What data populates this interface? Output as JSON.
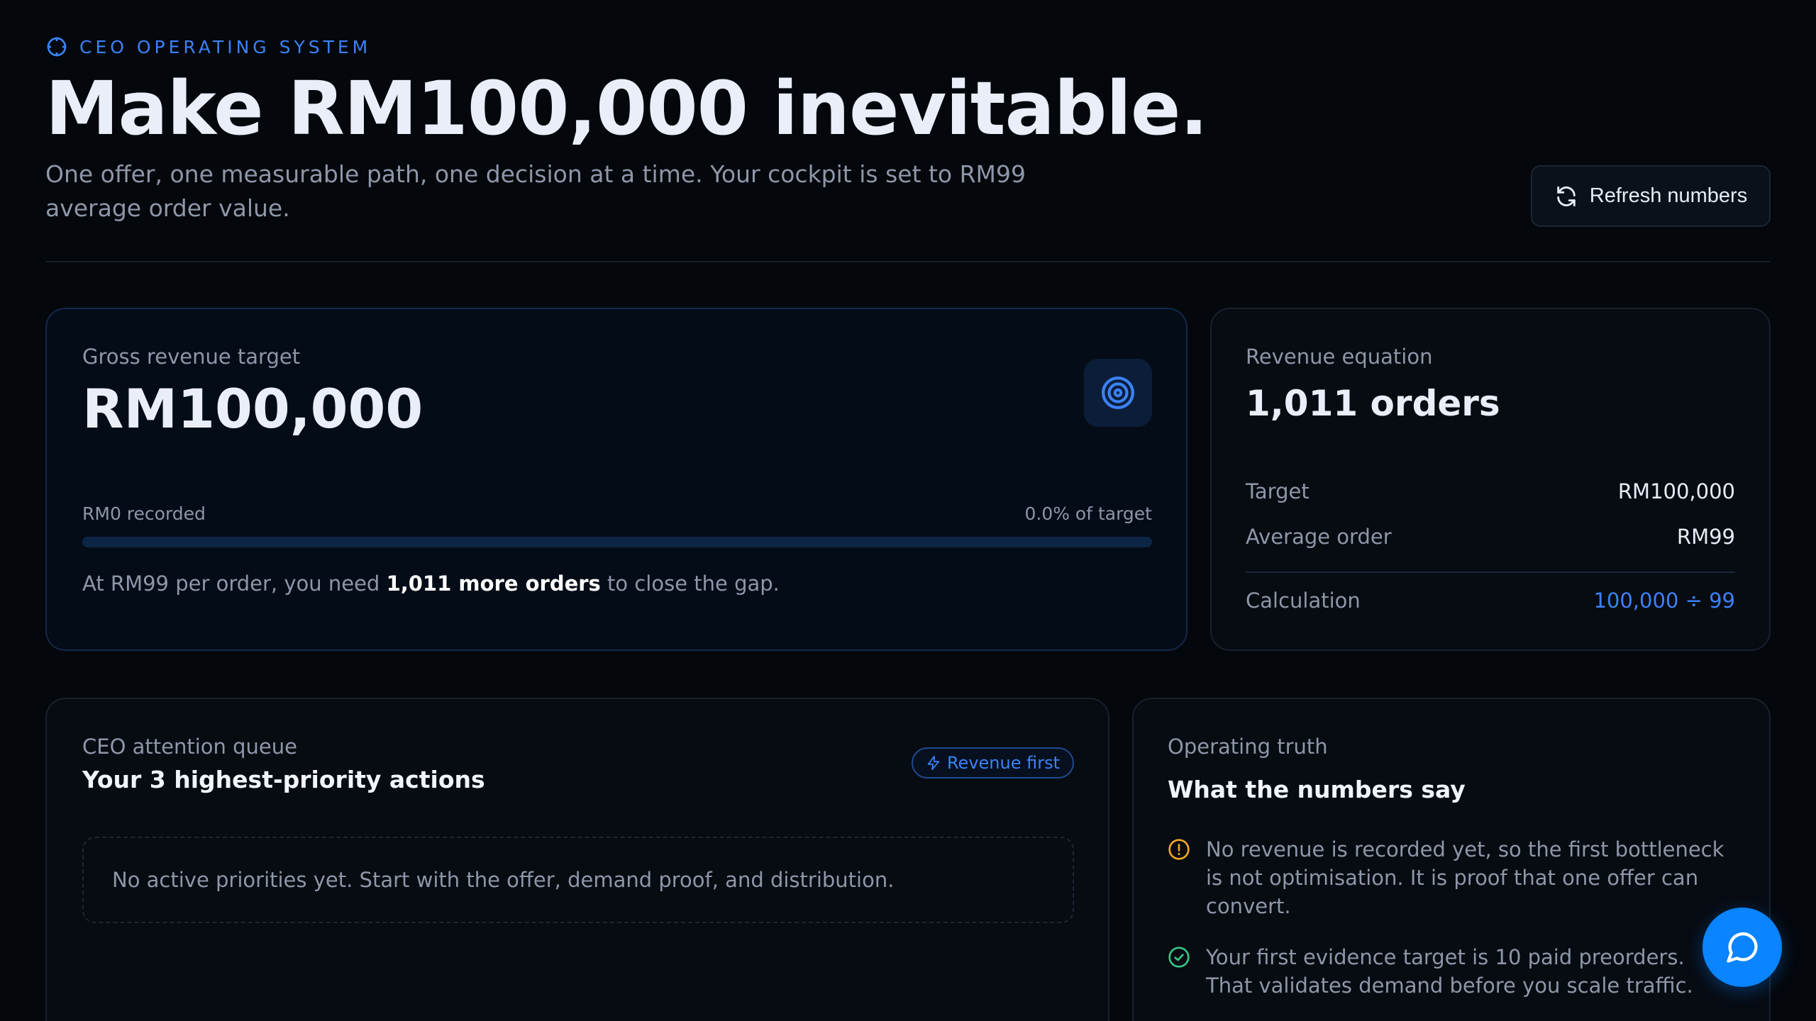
{
  "header": {
    "eyebrow": "CEO OPERATING SYSTEM",
    "headline": "Make RM100,000 inevitable.",
    "subtitle": "One offer, one measurable path, one decision at a time. Your cockpit is set to RM99 average order value.",
    "refresh_label": "Refresh numbers"
  },
  "target_card": {
    "label": "Gross revenue target",
    "value": "RM100,000",
    "recorded": "RM0 recorded",
    "percent_text": "0.0% of target",
    "progress_fraction": 0.0,
    "note_prefix": "At RM99 per order, you need ",
    "note_bold": "1,011 more orders",
    "note_suffix": " to close the gap."
  },
  "equation_card": {
    "label": "Revenue equation",
    "value": "1,011 orders",
    "rows": [
      {
        "key": "Target",
        "value": "RM100,000"
      },
      {
        "key": "Average order",
        "value": "RM99"
      },
      {
        "key": "Calculation",
        "value": "100,000 ÷ 99"
      }
    ]
  },
  "queue_card": {
    "label": "CEO attention queue",
    "title": "Your 3 highest-priority actions",
    "badge": "Revenue first",
    "empty_text": "No active priorities yet. Start with the offer, demand proof, and distribution."
  },
  "truth_card": {
    "label": "Operating truth",
    "title": "What the numbers say",
    "insights": [
      {
        "icon": "warning-circle-icon",
        "color": "#f5a623",
        "text": "No revenue is recorded yet, so the first bottleneck is not optimisation. It is proof that one offer can convert."
      },
      {
        "icon": "check-circle-icon",
        "color": "#34c785",
        "text": "Your first evidence target is 10 paid preorders. That validates demand before you scale traffic."
      }
    ]
  },
  "colors": {
    "accent": "#3b82f6",
    "fab": "#0a84ff",
    "background": "#04070c"
  }
}
